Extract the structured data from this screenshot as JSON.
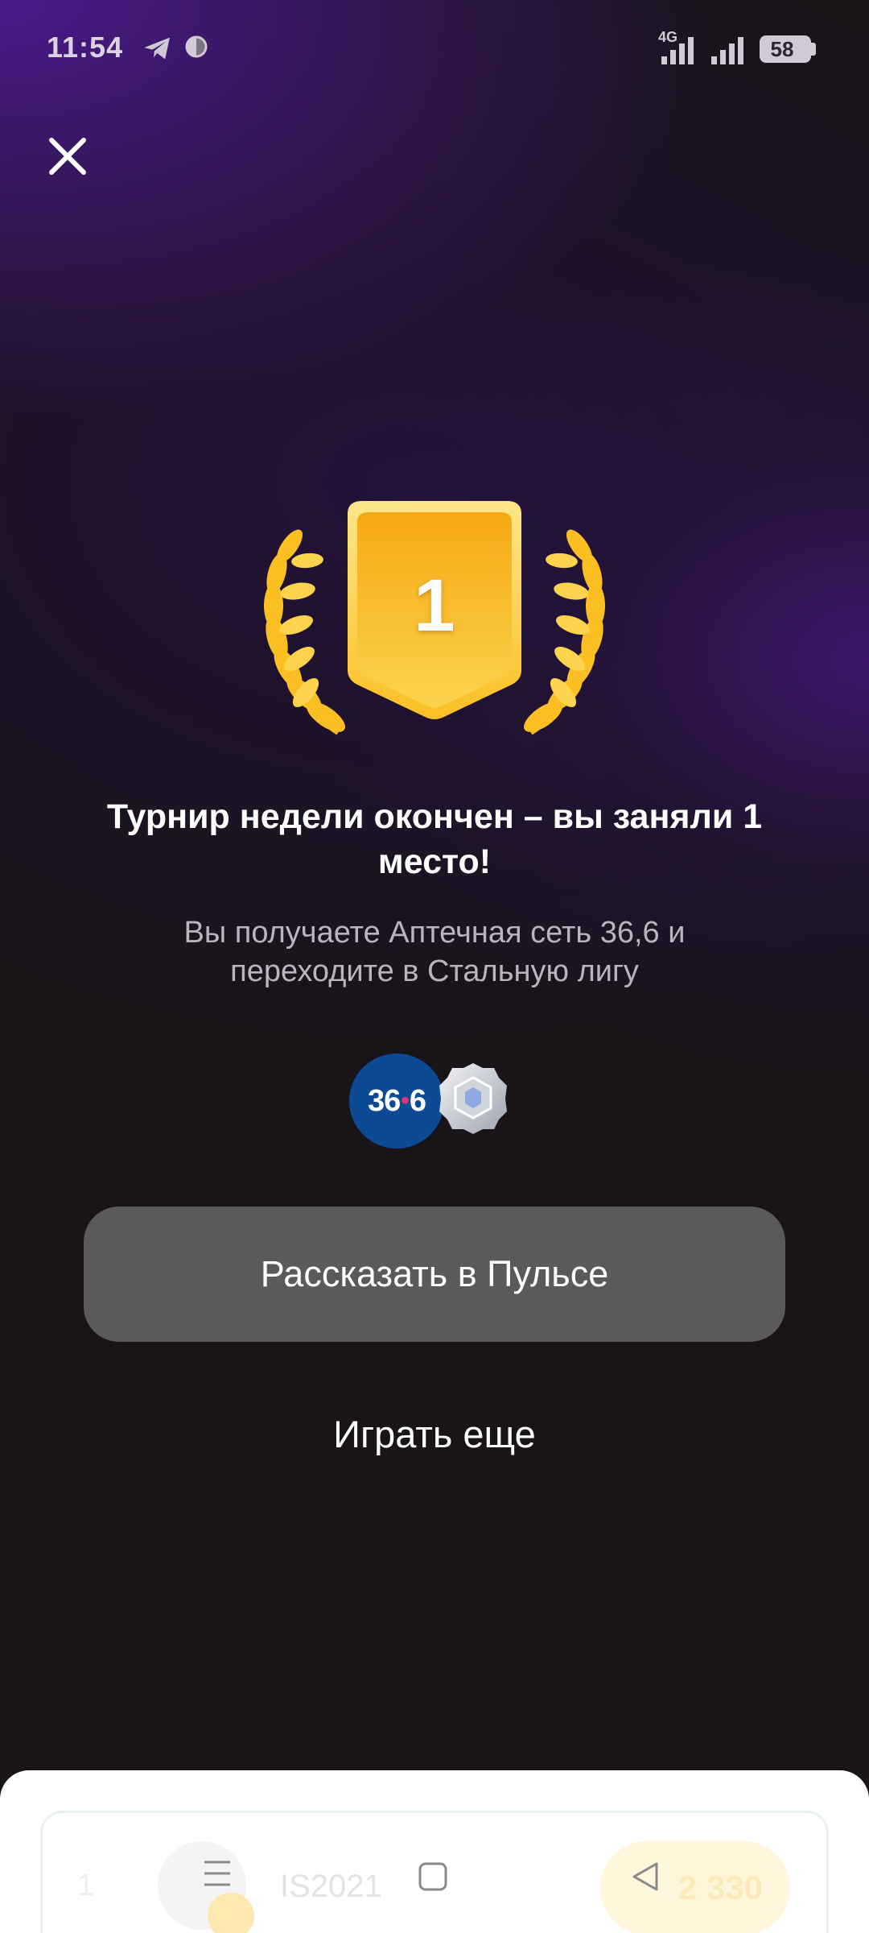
{
  "status_bar": {
    "time": "11:54",
    "network": "4G",
    "battery": "58",
    "icons": [
      "telegram-icon",
      "sync-icon",
      "signal-icon",
      "signal-icon",
      "battery-icon"
    ]
  },
  "trophy": {
    "place": "1",
    "colors": {
      "shield": "#fbbf24",
      "shield_dark": "#f59e0b",
      "laurel": "#fbbf24"
    }
  },
  "result": {
    "title": "Турнир недели окончен – вы заняли 1 место!",
    "subtitle": "Вы получаете Аптечная сеть 36,6 и переходите в Стальную лигу"
  },
  "rewards": {
    "partner_logo_left": "36",
    "partner_logo_right": "6",
    "league_badge": "steel-league-badge-icon"
  },
  "actions": {
    "share_label": "Рассказать в Пульсе",
    "play_again_label": "Играть еще"
  },
  "leaderboard_row": {
    "rank": "1",
    "name": "IS2021",
    "score": "2 330"
  },
  "colors": {
    "background": "#181418",
    "accent_purple": "#4a1a8c",
    "primary_button": "#5b595c"
  }
}
